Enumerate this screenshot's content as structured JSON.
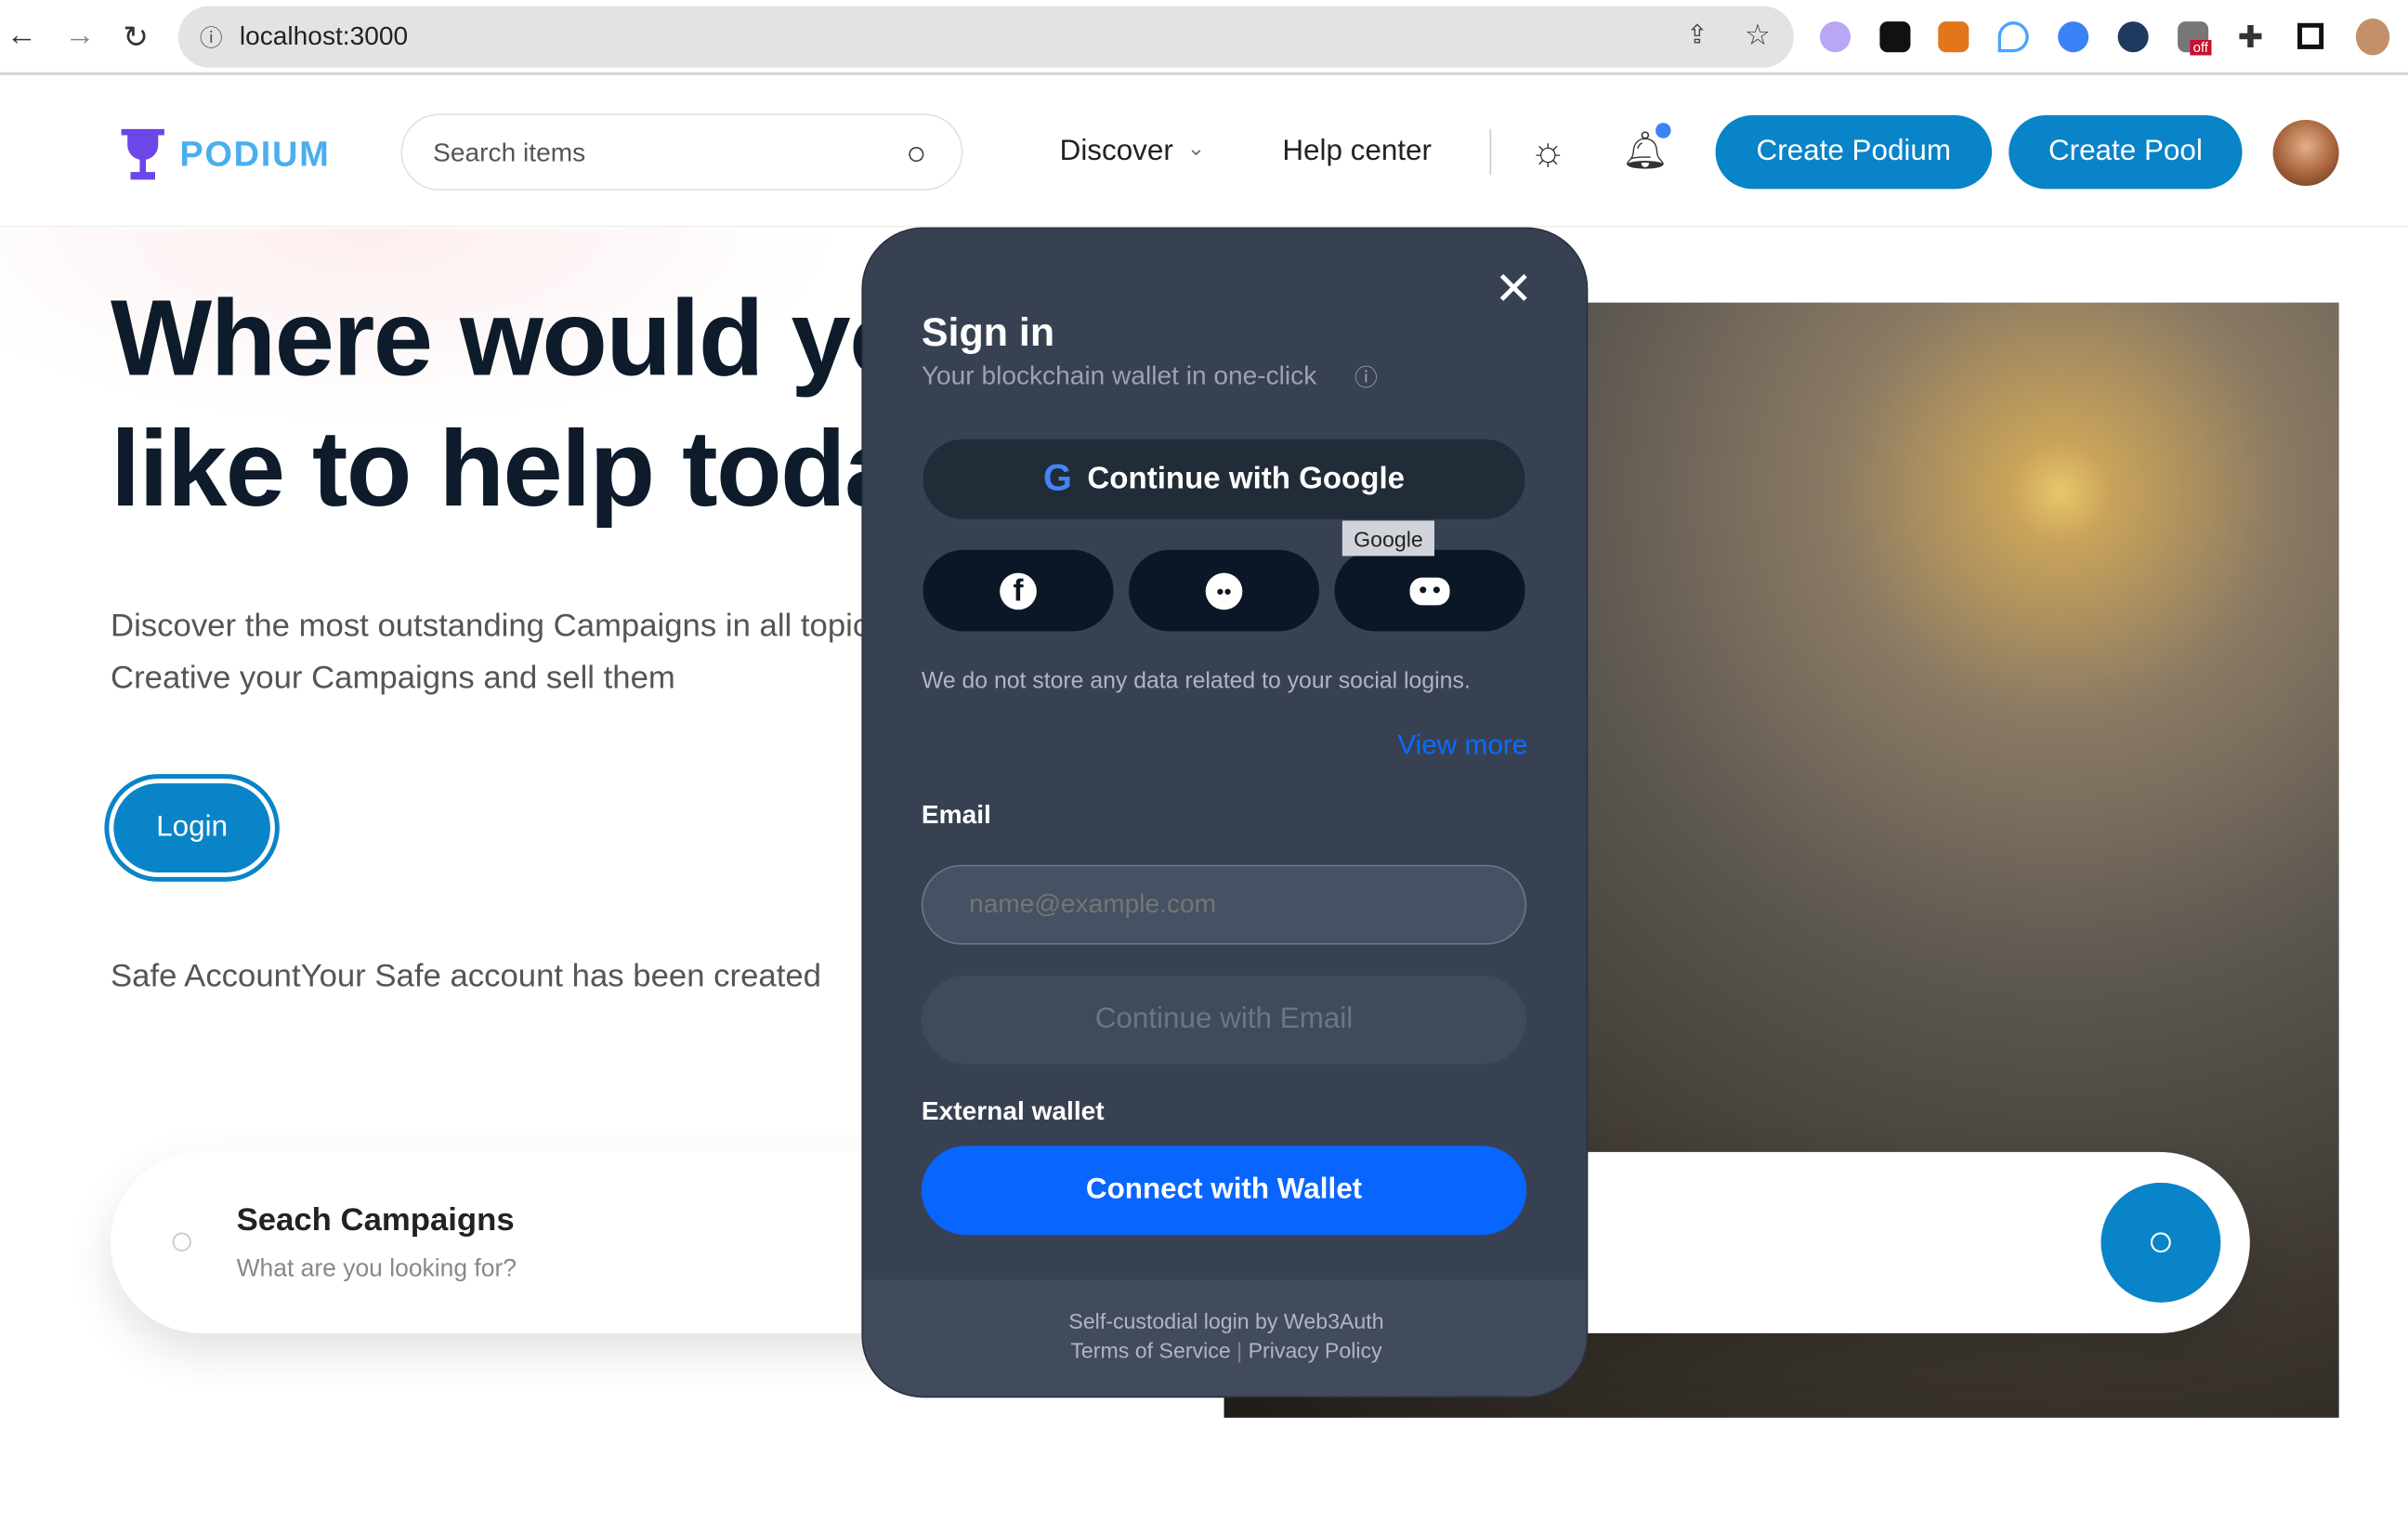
{
  "browser": {
    "url": "localhost:3000",
    "extension_off_badge": "off"
  },
  "header": {
    "logo": "PODIUM",
    "search_placeholder": "Search items",
    "discover": "Discover",
    "help_center": "Help center",
    "create_podium": "Create Podium",
    "create_pool": "Create Pool"
  },
  "hero": {
    "title_line1": "Where would you",
    "title_line2": "like to help today",
    "desc_line1": "Discover the most outstanding Campaigns in all topics.",
    "desc_line2": "Creative your Campaigns and sell them",
    "login": "Login",
    "status": "Safe AccountYour Safe account has been created"
  },
  "campaign_search": {
    "title": "Seach Campaigns",
    "subtitle": "What are you looking for?"
  },
  "modal": {
    "title": "Sign in",
    "subtitle": "Your blockchain wallet in one-click",
    "google_button": "Continue with Google",
    "tooltip": "Google",
    "note": "We do not store any data related to your social logins.",
    "view_more": "View more",
    "email_label": "Email",
    "email_placeholder": "name@example.com",
    "continue_email": "Continue with Email",
    "external_wallet_label": "External wallet",
    "connect_wallet": "Connect with Wallet",
    "footer_line1": "Self-custodial login by Web3Auth",
    "terms": "Terms of Service",
    "privacy": "Privacy Policy"
  },
  "colors": {
    "primary": "#0a84c8",
    "modal_bg": "#374152",
    "wallet_blue": "#0866ff"
  }
}
